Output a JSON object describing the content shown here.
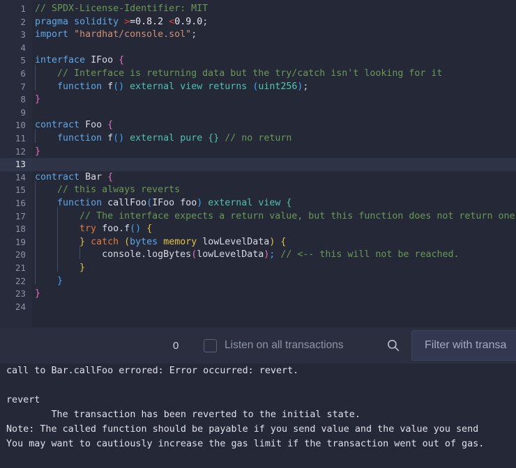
{
  "editor": {
    "language": "solidity",
    "active_line": 13,
    "total_lines": 24,
    "line_numbers": [
      "1",
      "2",
      "3",
      "4",
      "5",
      "6",
      "7",
      "8",
      "9",
      "10",
      "11",
      "12",
      "13",
      "14",
      "15",
      "16",
      "17",
      "18",
      "19",
      "20",
      "21",
      "22",
      "23",
      "24"
    ],
    "lines": [
      {
        "n": 1,
        "text": "// SPDX-License-Identifier: MIT"
      },
      {
        "n": 2,
        "text": "pragma solidity >=0.8.2 <0.9.0;"
      },
      {
        "n": 3,
        "text": "import \"hardhat/console.sol\";"
      },
      {
        "n": 4,
        "text": ""
      },
      {
        "n": 5,
        "text": "interface IFoo {"
      },
      {
        "n": 6,
        "text": "    // Interface is returning data but the try/catch isn't looking for it"
      },
      {
        "n": 7,
        "text": "    function f() external view returns (uint256);"
      },
      {
        "n": 8,
        "text": "}"
      },
      {
        "n": 9,
        "text": ""
      },
      {
        "n": 10,
        "text": "contract Foo {"
      },
      {
        "n": 11,
        "text": "    function f() external pure {} // no return"
      },
      {
        "n": 12,
        "text": "}"
      },
      {
        "n": 13,
        "text": ""
      },
      {
        "n": 14,
        "text": "contract Bar {"
      },
      {
        "n": 15,
        "text": "    // this always reverts"
      },
      {
        "n": 16,
        "text": "    function callFoo(IFoo foo) external view {"
      },
      {
        "n": 17,
        "text": "        // The interface expects a return value, but this function does not return one"
      },
      {
        "n": 18,
        "text": "        try foo.f() {"
      },
      {
        "n": 19,
        "text": "        } catch (bytes memory lowLevelData) {"
      },
      {
        "n": 20,
        "text": "            console.logBytes(lowLevelData); // <-- this will not be reached."
      },
      {
        "n": 21,
        "text": "        }"
      },
      {
        "n": 22,
        "text": "    }"
      },
      {
        "n": 23,
        "text": "}"
      },
      {
        "n": 24,
        "text": ""
      }
    ]
  },
  "toolbar": {
    "count": "0",
    "listen_label": "Listen on all transactions",
    "listen_checked": false,
    "search_icon": "search-icon",
    "filter_placeholder": "Filter with transa"
  },
  "terminal": {
    "lines": [
      "call to Bar.callFoo errored: Error occurred: revert.",
      "",
      "revert",
      "\tThe transaction has been reverted to the initial state.",
      "Note: The called function should be payable if you send value and the value you send",
      "You may want to cautiously increase the gas limit if the transaction went out of gas."
    ]
  },
  "colors": {
    "editor_bg": "#252837",
    "gutter_bg": "#282b3b",
    "panel_bg": "#2a2e3f",
    "active_line": "#2f3346",
    "comment": "#6a9955",
    "keyword": "#5fa8e8",
    "type": "#4ec9b0",
    "string": "#ce9178",
    "control": "#e07b3a",
    "brace_pink": "#e86fc0",
    "brace_yellow": "#e3c341",
    "brace_blue": "#3fa7f5",
    "text": "#d7dae3"
  }
}
